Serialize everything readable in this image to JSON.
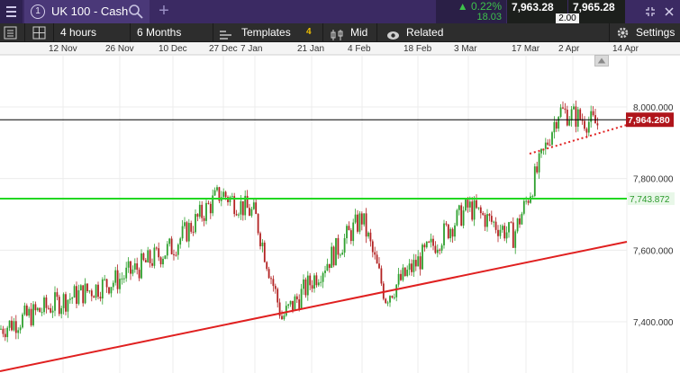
{
  "topbar": {
    "menu_icon": "hamburger-icon",
    "instrument_number": "1",
    "instrument_name": "UK 100 - Cash",
    "search_icon": "search-icon",
    "add_icon": "plus-icon",
    "change_percent": "0.22%",
    "change_points": "18.03",
    "sell_price": "7,963.28",
    "buy_price": "7,965.28",
    "spread": "2.00",
    "up_color": "#3ec04b"
  },
  "toolbar": {
    "interval": "4 hours",
    "range": "6 Months",
    "templates": "Templates",
    "templates_badge": "4",
    "price_type": "Mid",
    "related": "Related",
    "settings": "Settings"
  },
  "chart_data": {
    "type": "candlestick",
    "x_ticks": [
      "12 Nov",
      "26 Nov",
      "10 Dec",
      "27 Dec",
      "7 Jan",
      "21 Jan",
      "4 Feb",
      "18 Feb",
      "3 Mar",
      "17 Mar",
      "2 Apr",
      "14 Apr"
    ],
    "y_ticks": [
      "8,000.000",
      "7,800.000",
      "7,600.000",
      "7,400.000"
    ],
    "ylim": [
      7330,
      8060
    ],
    "path_points": [
      [
        "start",
        7380
      ],
      [
        "12 Nov",
        7460
      ],
      [
        "26 Nov",
        7520
      ],
      [
        "10 Dec",
        7610
      ],
      [
        "27 Dec",
        7760
      ],
      [
        "7 Jan",
        7700
      ],
      [
        "21 Jan",
        7410
      ],
      [
        "4 Feb",
        7690
      ],
      [
        "18 Feb",
        7470
      ],
      [
        "3 Mar",
        7720
      ],
      [
        "17 Mar",
        7640
      ],
      [
        "2 Apr",
        7760
      ],
      [
        "2 Apr",
        7990
      ],
      [
        "14 Apr",
        7950
      ]
    ],
    "current_price_label": "7,964.280",
    "current_price_level": 7964.28,
    "horizontal_level_label": "7,743.872",
    "horizontal_level": 7743.872,
    "trendline": {
      "color": "#e02020"
    },
    "up_color": "#2ea02e",
    "down_color": "#b22222",
    "support_color": "#22d822",
    "grid": true
  }
}
